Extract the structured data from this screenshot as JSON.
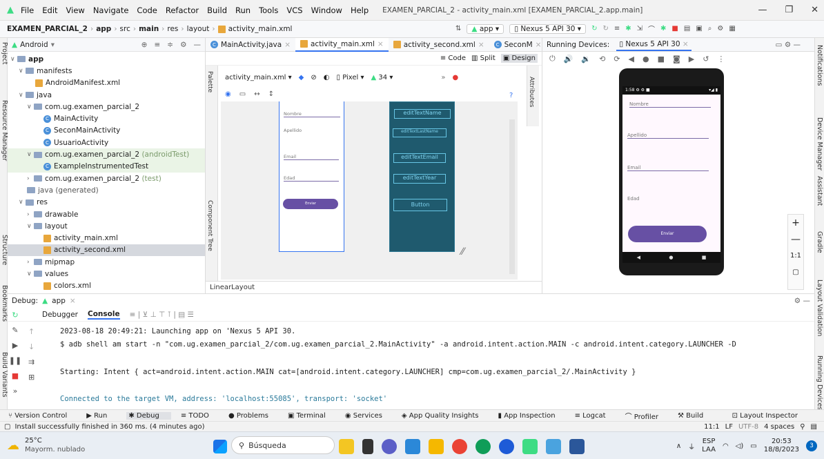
{
  "title_bar": {
    "menu": [
      "File",
      "Edit",
      "View",
      "Navigate",
      "Code",
      "Refactor",
      "Build",
      "Run",
      "Tools",
      "VCS",
      "Window",
      "Help"
    ],
    "window_title": "EXAMEN_PARCIAL_2 - activity_main.xml [EXAMEN_PARCIAL_2.app.main]"
  },
  "nav_bar": {
    "breadcrumbs": [
      "EXAMEN_PARCIAL_2",
      "app",
      "src",
      "main",
      "res",
      "layout",
      "activity_main.xml"
    ],
    "run_config": "app",
    "device": "Nexus 5 API 30"
  },
  "project": {
    "view": "Android",
    "items": [
      {
        "label": "app",
        "type": "folder",
        "bold": true
      },
      {
        "label": "manifests",
        "type": "folder"
      },
      {
        "label": "AndroidManifest.xml",
        "type": "xml"
      },
      {
        "label": "java",
        "type": "folder"
      },
      {
        "label": "com.ug.examen_parcial_2",
        "type": "folder"
      },
      {
        "label": "MainActivity",
        "type": "class"
      },
      {
        "label": "SeconMainActivity",
        "type": "class"
      },
      {
        "label": "UsuarioActivity",
        "type": "class"
      },
      {
        "label": "com.ug.examen_parcial_2",
        "suffix": "(androidTest)",
        "type": "folder",
        "green": true
      },
      {
        "label": "ExampleInstrumentedTest",
        "type": "class",
        "green": true
      },
      {
        "label": "com.ug.examen_parcial_2",
        "suffix": "(test)",
        "type": "folder"
      },
      {
        "label": "java (generated)",
        "type": "folder"
      },
      {
        "label": "res",
        "type": "folder"
      },
      {
        "label": "drawable",
        "type": "folder"
      },
      {
        "label": "layout",
        "type": "folder"
      },
      {
        "label": "activity_main.xml",
        "type": "xml"
      },
      {
        "label": "activity_second.xml",
        "type": "xml",
        "selected": true
      },
      {
        "label": "mipmap",
        "type": "folder"
      },
      {
        "label": "values",
        "type": "folder"
      },
      {
        "label": "colors.xml",
        "type": "xml"
      }
    ]
  },
  "editor": {
    "tabs": [
      "MainActivity.java",
      "activity_main.xml",
      "activity_second.xml",
      "SeconM"
    ],
    "modes": [
      "Code",
      "Split",
      "Design"
    ],
    "file_selector": "activity_main.xml",
    "device": "Pixel",
    "api": "34",
    "palette": "Palette",
    "component_tree": "Component Tree",
    "attributes": "Attributes",
    "status": "LinearLayout",
    "blueprint_fields": [
      "editTextName",
      "editTextLastName",
      "editTextEmail",
      "editTextYear",
      "Button"
    ],
    "design_fields": [
      "Nombre",
      "Apellido",
      "Email",
      "Edad"
    ],
    "design_button": "Enviar"
  },
  "running_devices": {
    "label": "Running Devices:",
    "device_tab": "Nexus 5 API 30",
    "phone_time": "1:58",
    "fields": [
      "Nombre",
      "Apellido",
      "Email",
      "Edad"
    ],
    "button": "Enviar",
    "zoom": "1:1"
  },
  "debug": {
    "label": "Debug:",
    "config": "app",
    "tabs": [
      "Debugger",
      "Console"
    ],
    "lines": [
      "2023-08-18 20:49:21: Launching app on 'Nexus 5 API 30.",
      "$ adb shell am start -n \"com.ug.examen_parcial_2/com.ug.examen_parcial_2.MainActivity\" -a android.intent.action.MAIN -c android.intent.category.LAUNCHER -D",
      "Starting: Intent { act=android.intent.action.MAIN cat=[android.intent.category.LAUNCHER] cmp=com.ug.examen_parcial_2/.MainActivity }",
      "Connected to the target VM, address: 'localhost:55085', transport: 'socket'"
    ]
  },
  "tool_windows": [
    "Version Control",
    "Run",
    "Debug",
    "TODO",
    "Problems",
    "Terminal",
    "Services",
    "App Quality Insights",
    "App Inspection",
    "Logcat",
    "Profiler",
    "Build"
  ],
  "layout_inspector": "Layout Inspector",
  "left_strip": [
    "Project",
    "Resource Manager",
    "Structure",
    "Bookmarks",
    "Build Variants"
  ],
  "right_strip": [
    "Notifications",
    "Device Manager",
    "Assistant",
    "Gradle",
    "Layout Validation",
    "Running Devices"
  ],
  "status": {
    "message": "Install successfully finished in 360 ms. (4 minutes ago)",
    "position": "11:1",
    "line_sep": "LF",
    "encoding": "UTF-8",
    "indent": "4 spaces"
  },
  "taskbar": {
    "temp": "25°C",
    "weather": "Mayorm. nublado",
    "search": "Búsqueda",
    "lang1": "ESP",
    "lang2": "LAA",
    "time": "20:53",
    "date": "18/8/2023",
    "badge": "3"
  }
}
